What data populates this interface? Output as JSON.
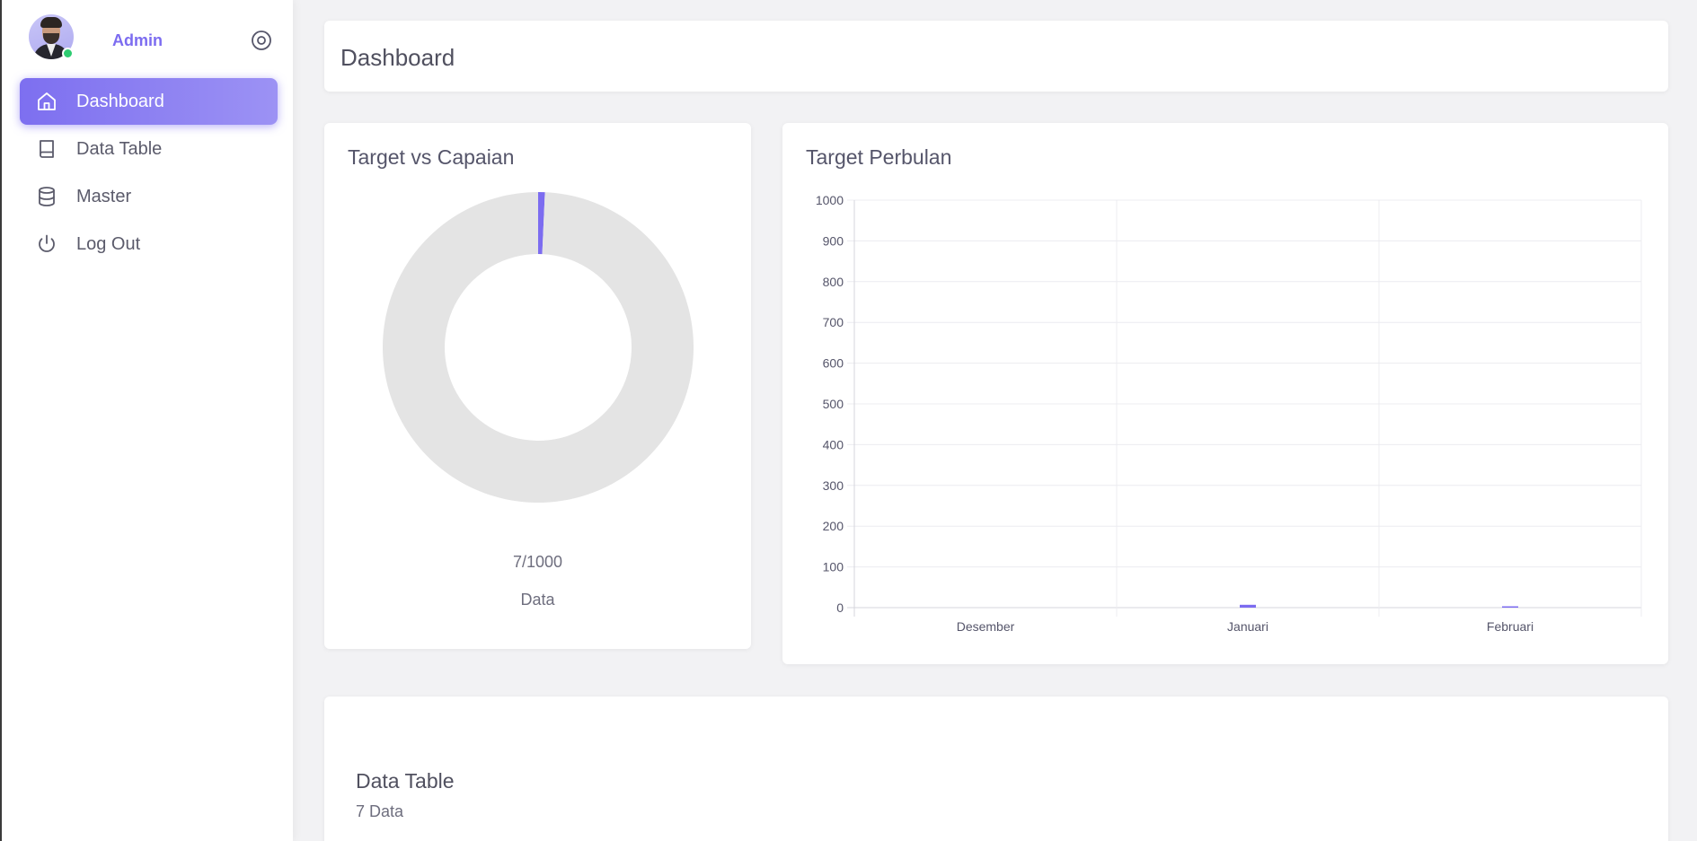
{
  "user": {
    "name": "Admin",
    "status_color": "#2ecc71"
  },
  "sidebar": {
    "items": [
      {
        "label": "Dashboard",
        "icon": "home-icon",
        "active": true
      },
      {
        "label": "Data Table",
        "icon": "book-icon",
        "active": false
      },
      {
        "label": "Master",
        "icon": "database-icon",
        "active": false
      },
      {
        "label": "Log Out",
        "icon": "power-icon",
        "active": false
      }
    ]
  },
  "header": {
    "title": "Dashboard"
  },
  "donut_card": {
    "title": "Target vs Capaian",
    "value_text": "7/1000",
    "caption": "Data"
  },
  "bar_card": {
    "title": "Target Perbulan"
  },
  "table_card": {
    "title": "Data Table",
    "count_text": "7 Data"
  },
  "colors": {
    "accent": "#7c6cf0",
    "donut_track": "#e4e4e4"
  },
  "chart_data": [
    {
      "type": "pie",
      "subtype": "donut",
      "title": "Target vs Capaian",
      "values": [
        7,
        993
      ],
      "colors": [
        "#7c6cf0",
        "#e4e4e4"
      ],
      "center_text": "7/1000",
      "caption": "Data"
    },
    {
      "type": "bar",
      "title": "Target Perbulan",
      "categories": [
        "Desember",
        "Januari",
        "Februari"
      ],
      "values": [
        0,
        7,
        1
      ],
      "ylim": [
        0,
        1000
      ],
      "yticks": [
        0,
        100,
        200,
        300,
        400,
        500,
        600,
        700,
        800,
        900,
        1000
      ],
      "grid": true,
      "color": "#7c6cf0"
    }
  ]
}
